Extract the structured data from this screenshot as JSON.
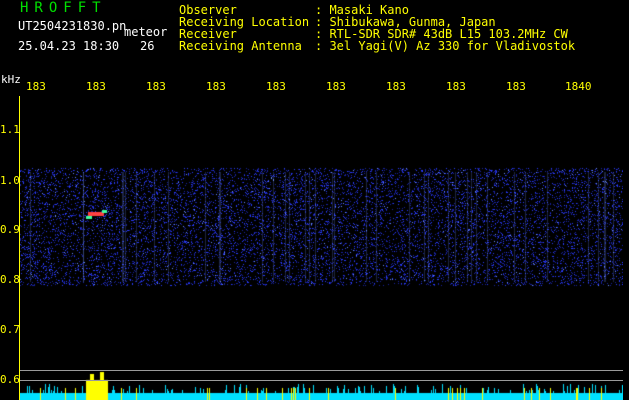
{
  "header": {
    "app_title": "HROFFT",
    "file_label": "UT2504231830.pn",
    "type_label": "meteor",
    "date_label": "25.04.23 18:30",
    "count_label": "26"
  },
  "info": [
    {
      "label": "Observer",
      "value": ": Masaki Kano"
    },
    {
      "label": "Receiving Location",
      "value": ": Shibukawa, Gunma, Japan"
    },
    {
      "label": "Receiver",
      "value": ": RTL-SDR SDR# 43dB L15 103.2MHz CW"
    },
    {
      "label": "Receiving Antenna",
      "value": ": 3el Yagi(V) Az 330 for Vladivostok"
    }
  ],
  "axis": {
    "unit": "kHz",
    "y_labels": [
      "1.1",
      "1.0",
      "0.9",
      "0.8",
      "0.7",
      "0.6"
    ],
    "x_labels": [
      "183",
      "183",
      "183",
      "183",
      "183",
      "183",
      "183",
      "183",
      "183",
      "1840"
    ]
  },
  "colors": {
    "background": "#000000",
    "text_white": "#ffffff",
    "text_yellow": "#ffff00",
    "title_green": "#00e000",
    "noise_blue": "#2a3cff",
    "echo_red": "#ff4040",
    "histogram_cyan": "#00e0ff",
    "histogram_peak": "#ffff00"
  }
}
